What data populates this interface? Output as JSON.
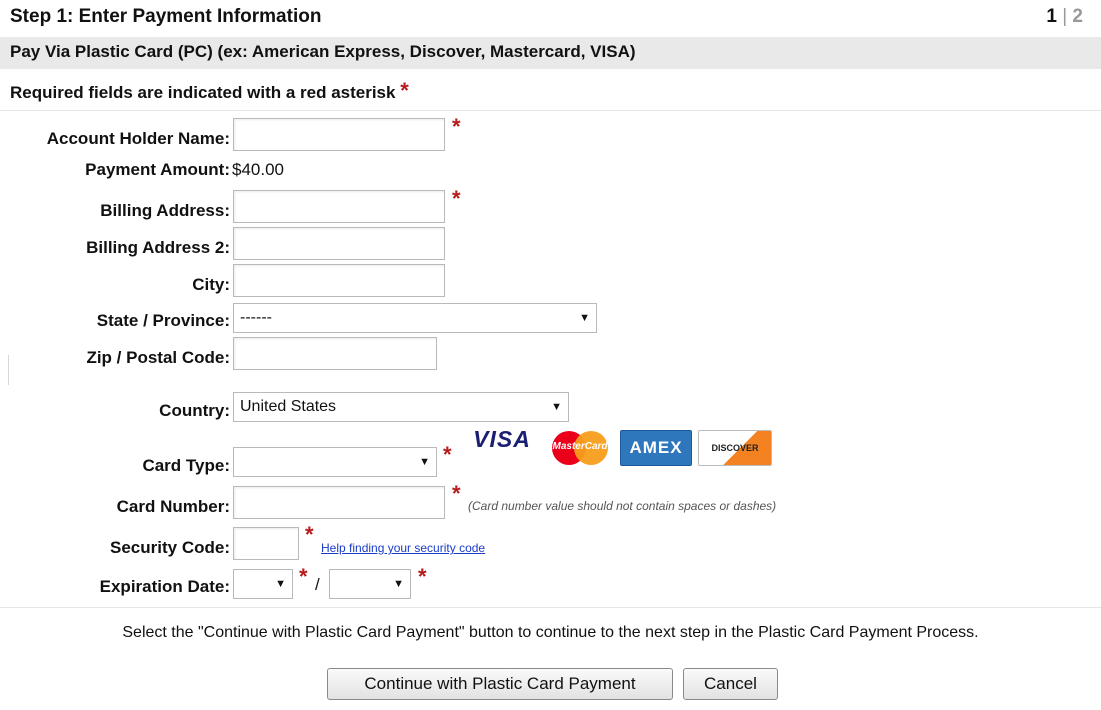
{
  "header": {
    "title": "Step 1: Enter Payment Information",
    "step_current": "1",
    "step_separator": "|",
    "step_next": "2"
  },
  "section": {
    "title": "Pay Via Plastic Card (PC) (ex: American Express, Discover, Mastercard, VISA)"
  },
  "required_note": {
    "text": "Required fields are indicated with a red asterisk",
    "asterisk": "*"
  },
  "form": {
    "account_holder_name": {
      "label": "Account Holder Name:",
      "value": ""
    },
    "payment_amount": {
      "label": "Payment Amount:",
      "value": "$40.00"
    },
    "billing_address": {
      "label": "Billing Address:",
      "value": ""
    },
    "billing_address_2": {
      "label": "Billing Address 2:",
      "value": ""
    },
    "city": {
      "label": "City:",
      "value": ""
    },
    "state": {
      "label": "State / Province:",
      "selected": "------"
    },
    "zip": {
      "label": "Zip / Postal Code:",
      "value": ""
    },
    "country": {
      "label": "Country:",
      "selected": "United States"
    },
    "card_type": {
      "label": "Card Type:",
      "selected": ""
    },
    "card_number": {
      "label": "Card Number:",
      "value": "",
      "note": "(Card number value should not contain spaces or dashes)"
    },
    "security_code": {
      "label": "Security Code:",
      "value": "",
      "help_link": "Help finding your security code"
    },
    "expiration": {
      "label": "Expiration Date:",
      "month": "",
      "year": "",
      "separator": "/"
    }
  },
  "card_logos": {
    "visa": "VISA",
    "mastercard": "MasterCard",
    "amex": "AMEX",
    "discover": "DISCOVER"
  },
  "instructions": "Select the \"Continue with Plastic Card Payment\" button to continue to the next step in the Plastic Card Payment Process.",
  "buttons": {
    "continue": "Continue with Plastic Card Payment",
    "cancel": "Cancel"
  },
  "colors": {
    "required": "#b71c1c",
    "link": "#1a3cc7",
    "band": "#e9e9e9",
    "visa_blue": "#1a1f71",
    "mastercard_red": "#eb001b",
    "mastercard_orange": "#f79e1b",
    "amex_blue": "#2e77bc",
    "discover_orange": "#f58220"
  }
}
